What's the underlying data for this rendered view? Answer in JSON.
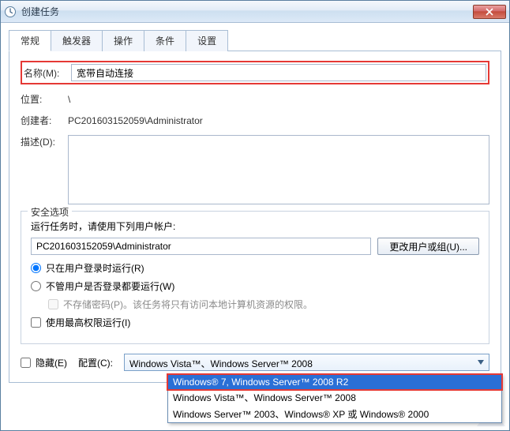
{
  "titlebar": {
    "title": "创建任务"
  },
  "tabs": {
    "items": [
      {
        "label": "常规"
      },
      {
        "label": "触发器"
      },
      {
        "label": "操作"
      },
      {
        "label": "条件"
      },
      {
        "label": "设置"
      }
    ]
  },
  "general": {
    "name_label": "名称(M):",
    "name_value": "宽带自动连接",
    "location_label": "位置:",
    "location_value": "\\",
    "creator_label": "创建者:",
    "creator_value": "PC201603152059\\Administrator",
    "desc_label": "描述(D):",
    "desc_value": ""
  },
  "security": {
    "group_title": "安全选项",
    "run_as_hint": "运行任务时，请使用下列用户帐户:",
    "user_account": "PC201603152059\\Administrator",
    "change_user_btn": "更改用户或组(U)...",
    "radio_logged_on": "只在用户登录时运行(R)",
    "radio_any": "不管用户是否登录都要运行(W)",
    "no_password_label": "不存储密码(P)。该任务将只有访问本地计算机资源的权限。",
    "highest_priv_label": "使用最高权限运行(I)"
  },
  "footer": {
    "hidden_label": "隐藏(E)",
    "config_label": "配置(C):",
    "combo_value": "Windows Vista™、Windows Server™ 2008",
    "dropdown": [
      "Windows® 7, Windows Server™ 2008 R2",
      "Windows Vista™、Windows Server™ 2008",
      "Windows Server™ 2003、Windows® XP 或 Windows® 2000"
    ]
  }
}
